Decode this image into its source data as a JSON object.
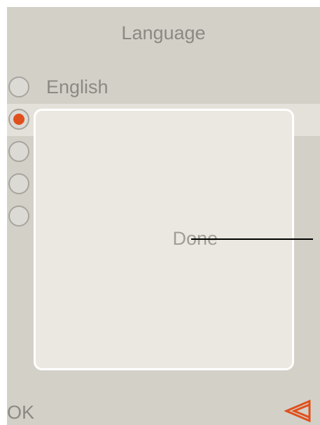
{
  "header": {
    "title": "Language"
  },
  "languages": [
    {
      "label": "English",
      "selected": false
    },
    {
      "label": "",
      "selected": true
    },
    {
      "label": "",
      "selected": false
    },
    {
      "label": "",
      "selected": false
    },
    {
      "label": "",
      "selected": false
    }
  ],
  "dialog": {
    "message": "Done"
  },
  "footer": {
    "ok_label": "OK",
    "back_icon": "double-chevron-left-icon"
  },
  "colors": {
    "screen_bg": "#d3d0c8",
    "text": "#8c8984",
    "accent": "#e0501c",
    "dialog_bg": "#ebe8e1",
    "dialog_border": "#ffffff"
  }
}
